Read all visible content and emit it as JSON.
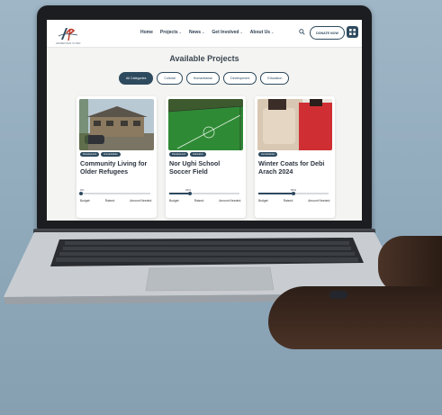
{
  "site": {
    "logo_text": "ARMENIAN FUND"
  },
  "nav": {
    "items": [
      {
        "label": "Home",
        "has_caret": false
      },
      {
        "label": "Projects",
        "has_caret": true
      },
      {
        "label": "News",
        "has_caret": true
      },
      {
        "label": "Get Involved",
        "has_caret": true
      },
      {
        "label": "About Us",
        "has_caret": true
      }
    ],
    "donate_label": "DONATE NOW"
  },
  "page": {
    "title": "Available Projects"
  },
  "filters": [
    {
      "label": "All Categories",
      "active": true
    },
    {
      "label": "Cultural",
      "active": false
    },
    {
      "label": "Humanitarian",
      "active": false
    },
    {
      "label": "Development",
      "active": false
    },
    {
      "label": "Education",
      "active": false
    }
  ],
  "cards": [
    {
      "tags": [
        "Development",
        "Humanitarian"
      ],
      "title": "Community Living for Older Refugees",
      "progress_label": "2%",
      "progress": 0.02,
      "stats": [
        "Budget:",
        "Raised:",
        "Amount Needed:"
      ],
      "image": "house-photo"
    },
    {
      "tags": [
        "Development",
        "Education"
      ],
      "title": "Nor Ughi School Soccer Field",
      "progress_label": "29%",
      "progress": 0.29,
      "stats": [
        "Budget:",
        "Raised:",
        "Amount Needed:"
      ],
      "image": "soccer-field-photo"
    },
    {
      "tags": [
        "Humanitarian"
      ],
      "title": "Winter Coats for Debi Arach 2024",
      "progress_label": "50%",
      "progress": 0.5,
      "stats": [
        "Budget:",
        "Raised:",
        "Amount Needed:"
      ],
      "image": "winter-coats-photo"
    }
  ],
  "colors": {
    "accent": "#2e4a5e",
    "page_bg": "#f4f4f2"
  }
}
